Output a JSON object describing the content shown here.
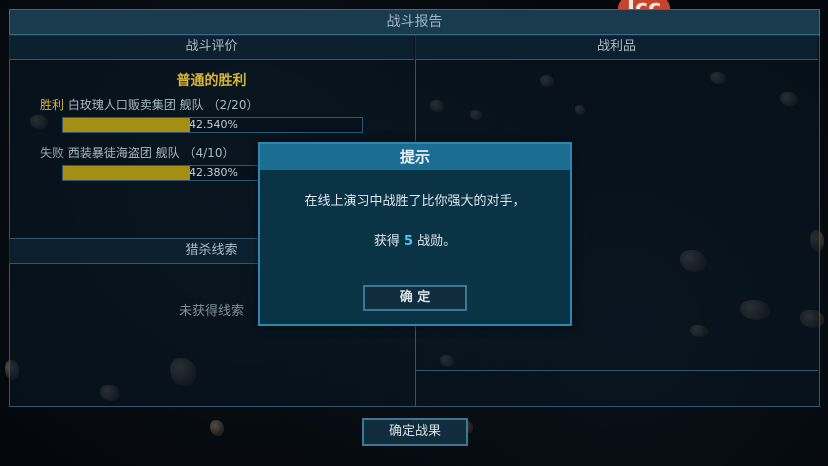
{
  "window": {
    "title": "战斗报告"
  },
  "logo": {
    "text": "Icc"
  },
  "left_panel": {
    "header": "战斗评价",
    "result_title": "普通的胜利",
    "teams": [
      {
        "tag": "胜利",
        "name": "白玫瑰人口贩卖集团 舰队",
        "count": "（2/20）",
        "percent": 42.54,
        "percent_label": "42.540%"
      },
      {
        "tag": "失败",
        "name": "西装暴徒海盗团 舰队",
        "count": "（4/10）",
        "percent": 42.38,
        "percent_label": "42.380%"
      }
    ],
    "clues_header": "猎杀线索",
    "no_clues": "未获得线索"
  },
  "right_panel": {
    "header": "战利品"
  },
  "confirm_results_button": "确定战果",
  "dialog": {
    "title": "提示",
    "message_line1": "在线上演习中战胜了比你强大的对手，",
    "message_prefix": "获得 ",
    "reward_value": "5",
    "message_suffix": " 战勋。",
    "ok_button": "确  定"
  },
  "colors": {
    "accent": "#1b6d92",
    "gold": "#d9b43a",
    "bar_fill": "#a48e14",
    "highlight": "#4fc6f2"
  }
}
